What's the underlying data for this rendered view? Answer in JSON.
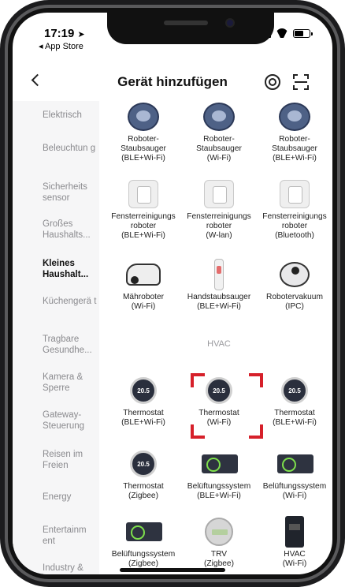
{
  "status": {
    "time": "17:19",
    "back_app": "◂ App Store"
  },
  "nav": {
    "title": "Gerät hinzufügen"
  },
  "categories": [
    {
      "label": "Elektrisch",
      "active": false
    },
    {
      "label": "Beleuchtun g",
      "active": false
    },
    {
      "label": "Sicherheits sensor",
      "active": false
    },
    {
      "label": "Großes Haushalts...",
      "active": false
    },
    {
      "label": "Kleines Haushalt...",
      "active": true
    },
    {
      "label": "Küchengerä t",
      "active": false
    },
    {
      "label": "Tragbare Gesundhe...",
      "active": false
    },
    {
      "label": "Kamera & Sperre",
      "active": false
    },
    {
      "label": "Gateway-Steuerung",
      "active": false
    },
    {
      "label": "Reisen im Freien",
      "active": false
    },
    {
      "label": "Energy",
      "active": false
    },
    {
      "label": "Entertainm ent",
      "active": false
    },
    {
      "label": "Industry & Agriculture",
      "active": false
    }
  ],
  "devices": [
    {
      "icon": "robot-vacuum-icon",
      "label": "Roboter-\nStaubsauger\n(BLE+Wi-Fi)"
    },
    {
      "icon": "robot-vacuum-icon",
      "label": "Roboter-\nStaubsauger\n(Wi-Fi)"
    },
    {
      "icon": "robot-vacuum-icon",
      "label": "Roboter-\nStaubsauger\n(BLE+Wi-Fi)"
    },
    {
      "icon": "window-robot-icon",
      "label": "Fensterreinigungs\nroboter\n(BLE+Wi-Fi)"
    },
    {
      "icon": "window-robot-icon",
      "label": "Fensterreinigungs\nroboter\n(W-lan)"
    },
    {
      "icon": "window-robot-icon",
      "label": "Fensterreinigungs\nroboter\n(Bluetooth)"
    },
    {
      "icon": "lawn-mower-icon",
      "label": "Mähroboter\n(Wi-Fi)"
    },
    {
      "icon": "handheld-vacuum-icon",
      "label": "Handstaubsauger\n(BLE+Wi-Fi)"
    },
    {
      "icon": "camera-robot-vacuum-icon",
      "label": "Robotervakuum\n(IPC)"
    },
    {
      "icon": "thermostat-icon",
      "label": "Thermostat\n(BLE+Wi-Fi)",
      "display": "20.5"
    },
    {
      "icon": "thermostat-icon",
      "label": "Thermostat\n(Wi-Fi)",
      "display": "20.5"
    },
    {
      "icon": "thermostat-icon",
      "label": "Thermostat\n(BLE+Wi-Fi)",
      "display": "20.5"
    },
    {
      "icon": "thermostat-icon",
      "label": "Thermostat\n(Zigbee)",
      "display": "20.5"
    },
    {
      "icon": "ventilation-icon",
      "label": "Belüftungssystem\n(BLE+Wi-Fi)"
    },
    {
      "icon": "ventilation-icon",
      "label": "Belüftungssystem\n(Wi-Fi)"
    },
    {
      "icon": "ventilation-icon",
      "label": "Belüftungssystem\n(Zigbee)"
    },
    {
      "icon": "trv-icon",
      "label": "TRV\n(Zigbee)"
    },
    {
      "icon": "hvac-panel-icon",
      "label": "HVAC\n(Wi-Fi)"
    }
  ],
  "section": {
    "hvac_label": "HVAC"
  },
  "colors": {
    "highlight": "#d6202a",
    "accent_green": "#7ee04c"
  }
}
